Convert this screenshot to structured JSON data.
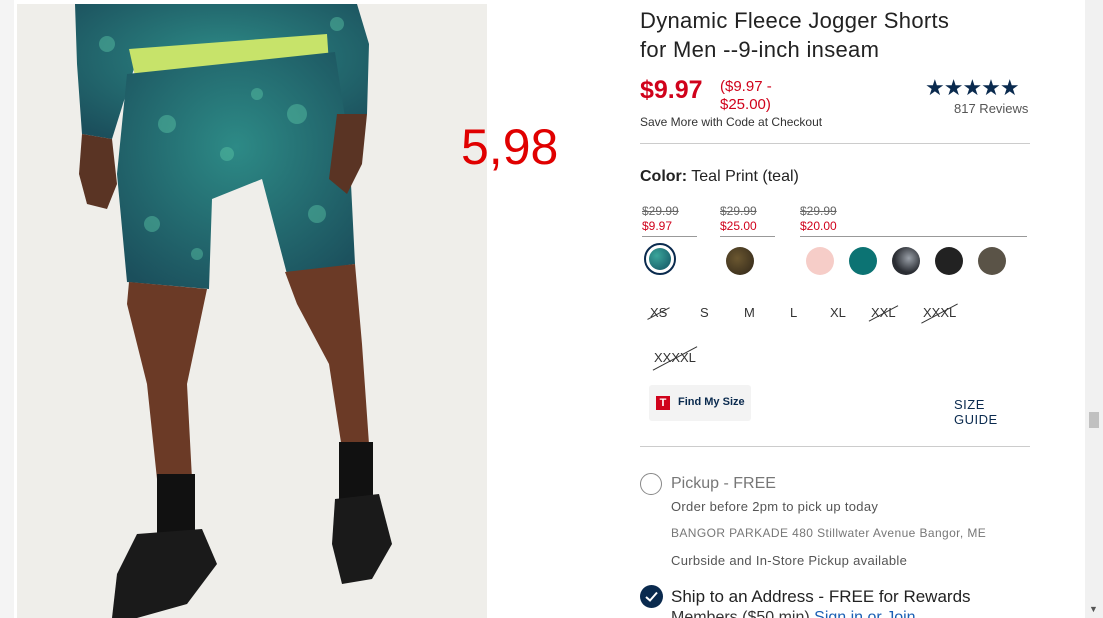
{
  "annotation": "5,98",
  "product": {
    "title_line1": "Dynamic Fleece Jogger Shorts",
    "title_line2": "for Men --9-inch inseam",
    "price": "$9.97",
    "range_line1": "($9.97 -",
    "range_line2": "$25.00)",
    "promo": "Save More with Code at Checkout",
    "stars": "★★★★★",
    "reviews": "817 Reviews"
  },
  "color": {
    "label": "Color:",
    "value": "Teal Print (teal)",
    "price_groups": [
      {
        "old": "$29.99",
        "new": "$9.97"
      },
      {
        "old": "$29.99",
        "new": "$25.00"
      },
      {
        "old": "$29.99",
        "new": "$20.00"
      }
    ],
    "swatches": [
      {
        "name": "teal-print",
        "color": "#1d6a72"
      },
      {
        "name": "olive-print",
        "color": "#4a3b22"
      },
      {
        "name": "light-pink",
        "color": "#f6cdc8"
      },
      {
        "name": "teal",
        "color": "#0c7373"
      },
      {
        "name": "black-marble",
        "color": "#2a2d33"
      },
      {
        "name": "black",
        "color": "#222222"
      },
      {
        "name": "dark-olive",
        "color": "#5a5347"
      }
    ]
  },
  "sizes": [
    "XS",
    "S",
    "M",
    "L",
    "XL",
    "XXL",
    "XXXL",
    "XXXXL"
  ],
  "sizes_unavailable": [
    "XS",
    "XXL",
    "XXXL",
    "XXXXL"
  ],
  "find_my_size": {
    "icon_letter": "T",
    "label": "Find My Size"
  },
  "size_guide": "SIZE GUIDE",
  "fulfillment": {
    "pickup_label": "Pickup - FREE",
    "pickup_time": "Order before 2pm to pick up today",
    "store_address": "BANGOR PARKADE 480 Stillwater Avenue Bangor, ME",
    "curbside": "Curbside and In-Store Pickup available",
    "ship_label": "Ship to an Address - FREE for Rewards",
    "ship_line2_prefix": "Members ($50 min)",
    "ship_signin": "Sign in or Join"
  }
}
